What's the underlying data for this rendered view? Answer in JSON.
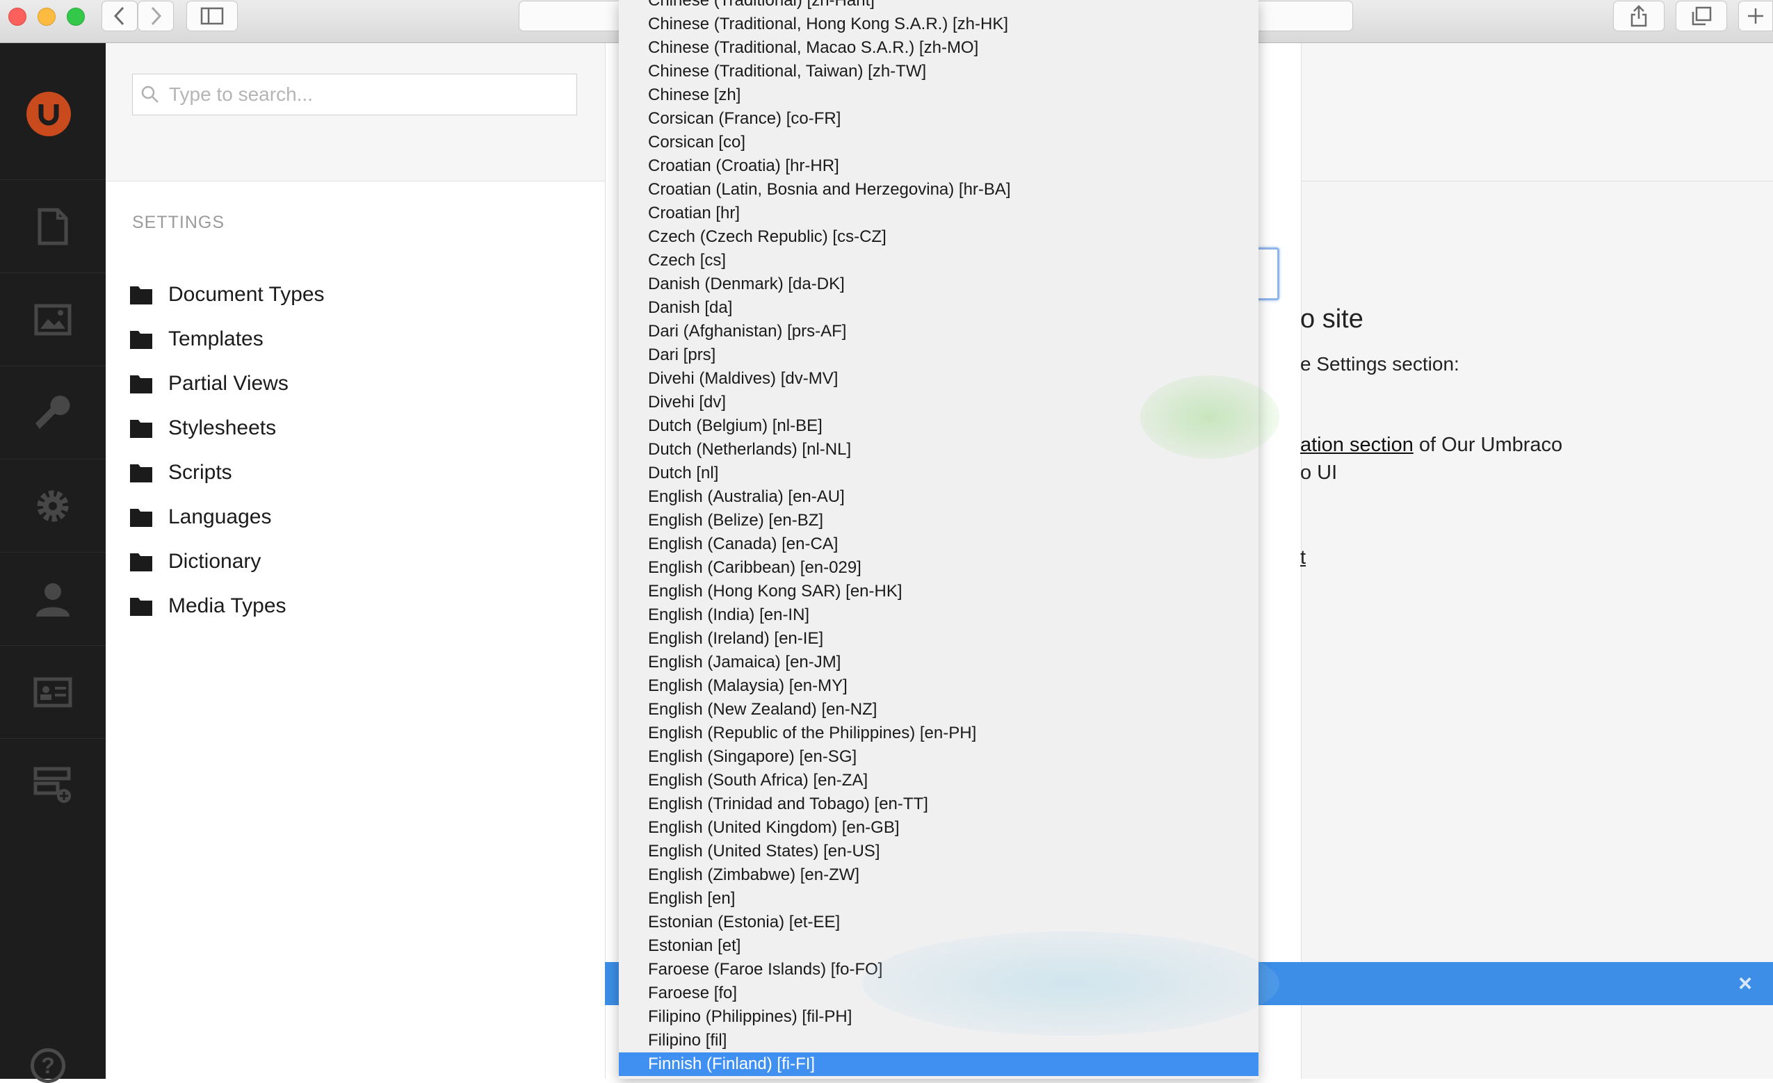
{
  "search": {
    "placeholder": "Type to search..."
  },
  "tree": {
    "section_title": "SETTINGS",
    "items": [
      {
        "label": "Document Types"
      },
      {
        "label": "Templates"
      },
      {
        "label": "Partial Views"
      },
      {
        "label": "Stylesheets"
      },
      {
        "label": "Scripts"
      },
      {
        "label": "Languages"
      },
      {
        "label": "Dictionary"
      },
      {
        "label": "Media Types"
      }
    ]
  },
  "left_nav": {
    "icons": [
      "content-icon",
      "media-icon",
      "developer-icon",
      "settings-icon",
      "users-icon",
      "members-icon",
      "forms-icon",
      "help-icon"
    ]
  },
  "welcome": {
    "title": "o site",
    "line1": "e Settings section:",
    "line2_link": "ation section",
    "line2_rest": " of Our Umbraco",
    "line3": "o UI",
    "link2": "t"
  },
  "notification": {
    "close": "×"
  },
  "language_dropdown": {
    "selected": "Finnish (Finland) [fi-FI]",
    "options": [
      "Chinese (Traditional) [zh-Hant]",
      "Chinese (Traditional, Hong Kong S.A.R.) [zh-HK]",
      "Chinese (Traditional, Macao S.A.R.) [zh-MO]",
      "Chinese (Traditional, Taiwan) [zh-TW]",
      "Chinese [zh]",
      "Corsican (France) [co-FR]",
      "Corsican [co]",
      "Croatian (Croatia) [hr-HR]",
      "Croatian (Latin, Bosnia and Herzegovina) [hr-BA]",
      "Croatian [hr]",
      "Czech (Czech Republic) [cs-CZ]",
      "Czech [cs]",
      "Danish (Denmark) [da-DK]",
      "Danish [da]",
      "Dari (Afghanistan) [prs-AF]",
      "Dari [prs]",
      "Divehi (Maldives) [dv-MV]",
      "Divehi [dv]",
      "Dutch (Belgium) [nl-BE]",
      "Dutch (Netherlands) [nl-NL]",
      "Dutch [nl]",
      "English (Australia) [en-AU]",
      "English (Belize) [en-BZ]",
      "English (Canada) [en-CA]",
      "English (Caribbean) [en-029]",
      "English (Hong Kong SAR) [en-HK]",
      "English (India) [en-IN]",
      "English (Ireland) [en-IE]",
      "English (Jamaica) [en-JM]",
      "English (Malaysia) [en-MY]",
      "English (New Zealand) [en-NZ]",
      "English (Republic of the Philippines) [en-PH]",
      "English (Singapore) [en-SG]",
      "English (South Africa) [en-ZA]",
      "English (Trinidad and Tobago) [en-TT]",
      "English (United Kingdom) [en-GB]",
      "English (United States) [en-US]",
      "English (Zimbabwe) [en-ZW]",
      "English [en]",
      "Estonian (Estonia) [et-EE]",
      "Estonian [et]",
      "Faroese (Faroe Islands) [fo-FO]",
      "Faroese [fo]",
      "Filipino (Philippines) [fil-PH]",
      "Filipino [fil]",
      "Finnish (Finland) [fi-FI]"
    ]
  },
  "colors": {
    "brand": "#c94a1d",
    "nav_bg": "#1d1d1d",
    "selection": "#3f90f0",
    "notification": "#3d8ee6"
  }
}
